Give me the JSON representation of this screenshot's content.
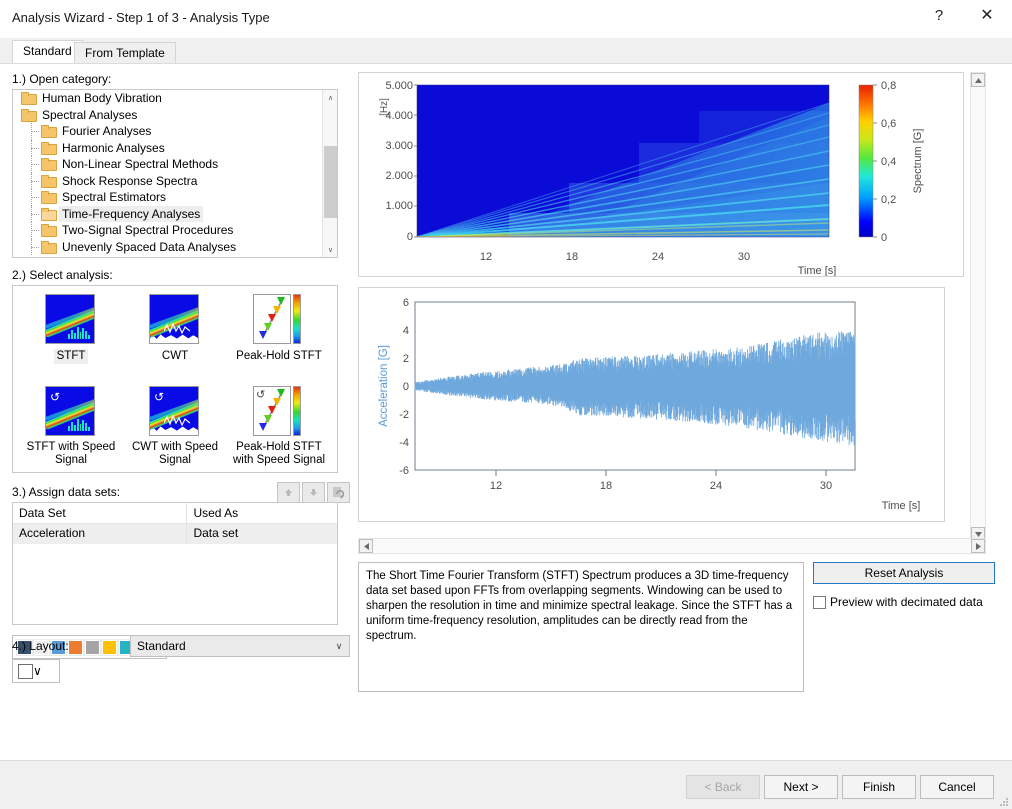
{
  "window": {
    "title": "Analysis Wizard - Step 1 of 3 - Analysis Type",
    "help_glyph": "?",
    "close_glyph": "✕"
  },
  "tabs": [
    {
      "label": "Standard",
      "active": true
    },
    {
      "label": "From Template",
      "active": false
    }
  ],
  "sections": {
    "category_label": "1.) Open category:",
    "analysis_label": "2.) Select analysis:",
    "datasets_label": "3.) Assign data sets:",
    "layout_label": "4.) Layout:"
  },
  "tree": {
    "items": [
      {
        "label": "Human Body Vibration",
        "level": 0,
        "selected": false,
        "open": false
      },
      {
        "label": "Spectral Analyses",
        "level": 0,
        "selected": false,
        "open": false
      },
      {
        "label": "Fourier Analyses",
        "level": 1,
        "selected": false,
        "open": false
      },
      {
        "label": "Harmonic Analyses",
        "level": 1,
        "selected": false,
        "open": false
      },
      {
        "label": "Non-Linear Spectral Methods",
        "level": 1,
        "selected": false,
        "open": false
      },
      {
        "label": "Shock Response Spectra",
        "level": 1,
        "selected": false,
        "open": false
      },
      {
        "label": "Spectral Estimators",
        "level": 1,
        "selected": false,
        "open": false
      },
      {
        "label": "Time-Frequency Analyses",
        "level": 1,
        "selected": true,
        "open": true
      },
      {
        "label": "Two-Signal Spectral Procedures",
        "level": 1,
        "selected": false,
        "open": false
      },
      {
        "label": "Unevenly Spaced Data Analyses",
        "level": 1,
        "selected": false,
        "open": false
      }
    ],
    "scroll_up_glyph": "∧",
    "scroll_down_glyph": "∨"
  },
  "analyses": [
    {
      "label": "STFT",
      "icon": "stft-icon",
      "selected": true,
      "speed": false,
      "kind": "spec-bars"
    },
    {
      "label": "CWT",
      "icon": "cwt-icon",
      "selected": false,
      "speed": false,
      "kind": "spec-wave"
    },
    {
      "label": "Peak-Hold STFT",
      "icon": "peak-hold-stft-icon",
      "selected": false,
      "speed": false,
      "kind": "peak"
    },
    {
      "label": "STFT with Speed Signal",
      "icon": "stft-with-speed-signal-icon",
      "selected": false,
      "speed": true,
      "kind": "spec-bars"
    },
    {
      "label": "CWT with Speed Signal",
      "icon": "cwt-with-speed-signal-icon",
      "selected": false,
      "speed": true,
      "kind": "spec-wave"
    },
    {
      "label": "Peak-Hold STFT with Speed Signal",
      "icon": "peak-hold-stft-with-speed-signal-icon",
      "selected": false,
      "speed": true,
      "kind": "peak"
    }
  ],
  "datasets": {
    "toolbar": [
      {
        "name": "move-up-button",
        "glyph": "▲",
        "enabled": false
      },
      {
        "name": "move-down-button",
        "glyph": "▼",
        "enabled": false
      },
      {
        "name": "refresh-button",
        "glyph": "↻",
        "enabled": false
      }
    ],
    "columns": [
      "Data Set",
      "Used As"
    ],
    "rows": [
      {
        "data_set": "Acceleration",
        "used_as": "Data set",
        "selected": true
      }
    ]
  },
  "layout": {
    "value": "Standard",
    "chevron": "∨",
    "palette": [
      "#36506b",
      "#eeeeee",
      "#5b9bd5",
      "#ed7d31",
      "#a5a5a5",
      "#ffc000",
      "#27b3c2",
      "#70ad47"
    ],
    "line_swatch": "#ffffff"
  },
  "description": "The Short Time Fourier Transform (STFT) Spectrum produces a 3D time-frequency data set based upon FFTs from overlapping segments. Windowing can be used to sharpen the resolution in time and minimize spectral leakage. Since the STFT has a uniform time-frequency resolution, amplitudes can be directly read from the spectrum.",
  "controls": {
    "reset_label": "Reset Analysis",
    "preview_label": "Preview with decimated data",
    "preview_checked": false
  },
  "wizard_buttons": [
    {
      "label": "< Back",
      "name": "back-button",
      "enabled": false
    },
    {
      "label": "Next >",
      "name": "next-button",
      "enabled": true
    },
    {
      "label": "Finish",
      "name": "finish-button",
      "enabled": true
    },
    {
      "label": "Cancel",
      "name": "cancel-button",
      "enabled": true
    }
  ],
  "chart_data": [
    {
      "type": "heatmap",
      "name": "stft-spectrogram",
      "title": "",
      "xlabel": "Time [s]",
      "ylabel": "[Hz]",
      "xticks": [
        12,
        18,
        24,
        30
      ],
      "xticklabels": [
        "12",
        "18",
        "24",
        "30"
      ],
      "xlim": [
        9,
        33
      ],
      "yticks": [
        0,
        1000,
        2000,
        3000,
        4000,
        5000
      ],
      "yticklabels": [
        "0",
        "1.000",
        "2.000",
        "3.000",
        "4.000",
        "5.000"
      ],
      "ylim": [
        0,
        5000
      ],
      "colorbar": {
        "label": "Spectrum [G]",
        "ticks": [
          0,
          0.2,
          0.4,
          0.6,
          0.8
        ],
        "ticklabels": [
          "0",
          "0,2",
          "0,4",
          "0,6",
          "0,8"
        ],
        "vmin": 0,
        "vmax": 0.8,
        "colormap": "jet"
      },
      "description": "Run-up order spectrogram: harmonic order lines fan out linearly from the origin as rotational speed increases with time; energy concentrated below 4.400 Hz, strongest near 500-700 Hz at late times.",
      "order_lines_slope_hz_per_s": [
        18,
        37,
        55,
        74,
        92,
        110,
        129,
        147,
        166,
        184
      ],
      "grid": false
    },
    {
      "type": "line",
      "name": "acceleration-time-signal",
      "title": "",
      "xlabel": "Time [s]",
      "ylabel": "Acceleration [G]",
      "xticks": [
        12,
        18,
        24,
        30
      ],
      "xticklabels": [
        "12",
        "18",
        "24",
        "30"
      ],
      "xlim": [
        9,
        33
      ],
      "yticks": [
        -6,
        -4,
        -2,
        0,
        2,
        4,
        6
      ],
      "yticklabels": [
        "-6",
        "-4",
        "-2",
        "0",
        "2",
        "4",
        "6"
      ],
      "ylim": [
        -6,
        6
      ],
      "series": [
        {
          "name": "Acceleration",
          "color": "#6fa8dc",
          "envelope_x": [
            9,
            12,
            15,
            17,
            18,
            21,
            24,
            27,
            30,
            33
          ],
          "envelope_pos": [
            0.3,
            0.9,
            1.3,
            1.6,
            2.0,
            2.2,
            2.5,
            2.8,
            3.6,
            4.2
          ],
          "envelope_neg": [
            -0.3,
            -0.9,
            -1.2,
            -1.5,
            -2.1,
            -2.3,
            -2.6,
            -3.0,
            -3.7,
            -4.3
          ]
        }
      ],
      "grid": false
    }
  ]
}
